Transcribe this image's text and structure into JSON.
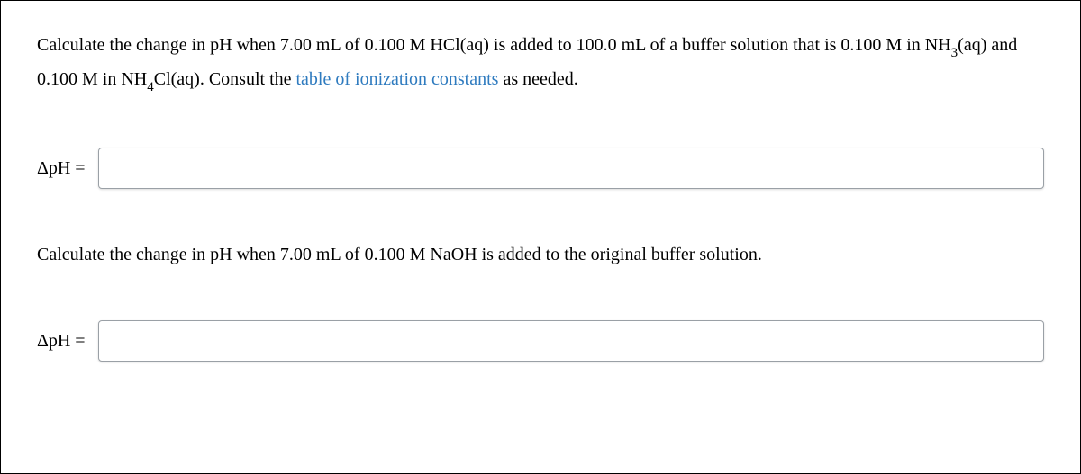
{
  "q1": {
    "t1": "Calculate the change in pH when 7.00 mL of 0.100 M HCl(aq) is added to 100.0 mL of a buffer solution that is 0.100 M in ",
    "t2": "NH",
    "s1": "3",
    "t3": "(aq) and 0.100 M in NH",
    "s2": "4",
    "t4": "Cl(aq). Consult the ",
    "link": "table of ionization constants",
    "t5": " as needed."
  },
  "q2": {
    "text": "Calculate the change in pH when 7.00 mL of 0.100 M NaOH is added to the original buffer solution."
  },
  "label": "ΔpH ="
}
